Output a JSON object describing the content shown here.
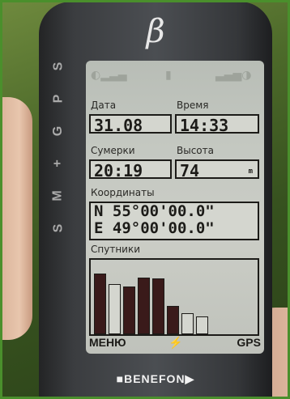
{
  "device": {
    "top_logo": "β",
    "side_letters": [
      "S",
      "P",
      "G",
      "+",
      "M",
      "S"
    ],
    "brand": "■BENEFON▶"
  },
  "screen": {
    "labels": {
      "date": "Дата",
      "time": "Время",
      "twilight": "Сумерки",
      "altitude": "Высота",
      "coordinates": "Координаты",
      "satellites": "Спутники"
    },
    "values": {
      "date": "31.08",
      "time": "14:33",
      "twilight": "20:19",
      "altitude": "74",
      "altitude_unit": "m",
      "lat": "N 55°00'00.0\"",
      "lon": "E 49°00'00.0\""
    },
    "satellite_bars": [
      {
        "level": 0.85,
        "filled": true
      },
      {
        "level": 0.7,
        "filled": false
      },
      {
        "level": 0.67,
        "filled": true
      },
      {
        "level": 0.8,
        "filled": true
      },
      {
        "level": 0.78,
        "filled": true
      },
      {
        "level": 0.4,
        "filled": true
      },
      {
        "level": 0.3,
        "filled": false
      },
      {
        "level": 0.25,
        "filled": false
      }
    ],
    "softkeys": {
      "left": "МЕНЮ",
      "right": "GPS"
    }
  }
}
